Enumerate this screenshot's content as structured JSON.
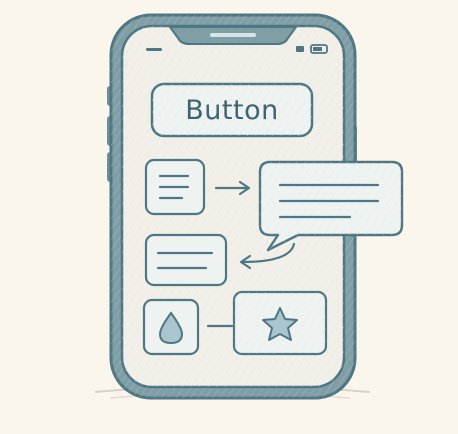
{
  "button": {
    "label": "Button"
  },
  "colors": {
    "background": "#fbf6ec",
    "stroke": "#4f7683",
    "fill_light": "#eef3f2",
    "fill_mid": "#d7e4e6",
    "fill_dark": "#9ab4bb",
    "accent_fill": "#a9c6cf"
  },
  "icons": {
    "drop": "water-drop-icon",
    "star": "star-icon",
    "arrow_right": "arrow-right-icon",
    "arrow_back": "curved-arrow-icon"
  }
}
